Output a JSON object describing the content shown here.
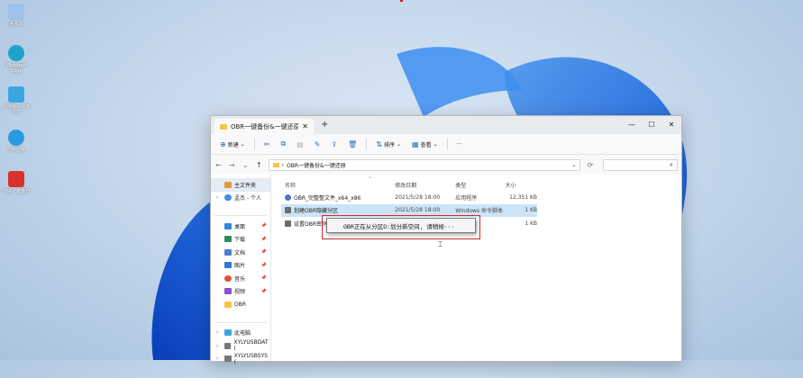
{
  "desktop": {
    "icons": [
      {
        "label": "回收站",
        "color": "#9fc3e8"
      },
      {
        "label": "Microsoft Edge",
        "color": "#1fa4c9"
      },
      {
        "label": "此电脑 - 快捷方式",
        "color": "#3aa7e0"
      },
      {
        "label": "控制面板",
        "color": "#2a9be0"
      },
      {
        "label": "OBR一键备份",
        "color": "#d8322f"
      }
    ]
  },
  "window": {
    "tab_title": "OBR一键备份&一键还原",
    "tab_close": "✕",
    "new_tab": "+",
    "controls": {
      "minimize": "—",
      "maximize": "☐",
      "close": "✕"
    }
  },
  "toolbar": {
    "new_label": "新建",
    "sort_label": "排序",
    "view_label": "查看",
    "more_label": "···"
  },
  "address": {
    "path": "OBR一键备份&一键还原",
    "search_icon": "⌕"
  },
  "sidebar": {
    "items": [
      {
        "label": "主文件夹",
        "color": "#e6973a",
        "active": true,
        "chev": ""
      },
      {
        "label": "孟杰 - 个人",
        "color": "#3b8fe0",
        "chev": "›"
      },
      {
        "label": "桌面",
        "color": "#2d8ae0",
        "pin": true
      },
      {
        "label": "下载",
        "color": "#2b8f5a",
        "pin": true
      },
      {
        "label": "文档",
        "color": "#4e7fd0",
        "pin": true
      },
      {
        "label": "图片",
        "color": "#2e7ad6",
        "pin": true
      },
      {
        "label": "音乐",
        "color": "#e0503a",
        "pin": true
      },
      {
        "label": "视频",
        "color": "#8b4fd0",
        "pin": true
      },
      {
        "label": "OBR",
        "color": "#f5c440"
      }
    ],
    "lower_items": [
      {
        "label": "此电脑",
        "color": "#3aa7e0",
        "chev": "›"
      },
      {
        "label": "XYLYUSBDAT (",
        "color": "#777777",
        "chev": "›"
      },
      {
        "label": "XYLYUSBSYS (",
        "color": "#777777",
        "chev": "›"
      }
    ]
  },
  "filelist": {
    "headers": {
      "name": "名称",
      "date": "修改日期",
      "type": "类型",
      "size": "大小"
    },
    "rows": [
      {
        "name": "OBR_完整整文件_x64_x86",
        "date": "2021/5/28 18:00",
        "type": "应用程序",
        "size": "12,351 KB",
        "color": "#4a7bc9",
        "selected": false
      },
      {
        "name": "划建OBR隐藏分区",
        "date": "2021/5/28 18:00",
        "type": "Windows 命令脚本",
        "size": "1 KB",
        "color": "#6b6b6b",
        "selected": true
      },
      {
        "name": "设置OBR密码",
        "date": "",
        "type": "命令脚本",
        "size": "1 KB",
        "color": "#6b6b6b",
        "selected": false
      }
    ]
  },
  "dialog": {
    "message": "OBR正在从分区D:划分新空间, 请稍候···"
  }
}
